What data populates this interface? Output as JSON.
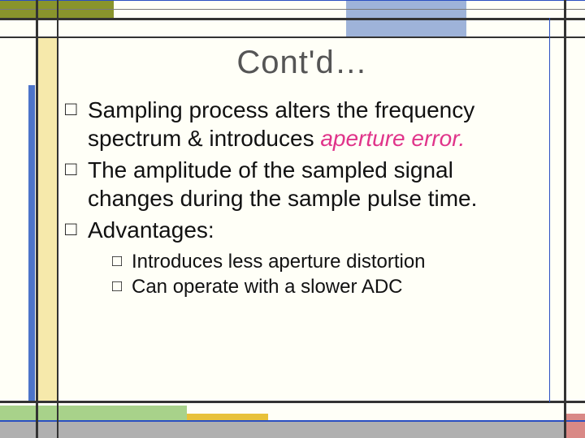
{
  "title": "Cont'd…",
  "bullets": {
    "b1_pre": "Sampling process alters the frequency spectrum & introduces ",
    "b1_em": "aperture error.",
    "b2": "The amplitude of the sampled signal changes during the sample pulse time.",
    "b3": "Advantages:"
  },
  "sub": {
    "s1": "Introduces less aperture distortion",
    "s2": "Can operate with a slower ADC"
  }
}
